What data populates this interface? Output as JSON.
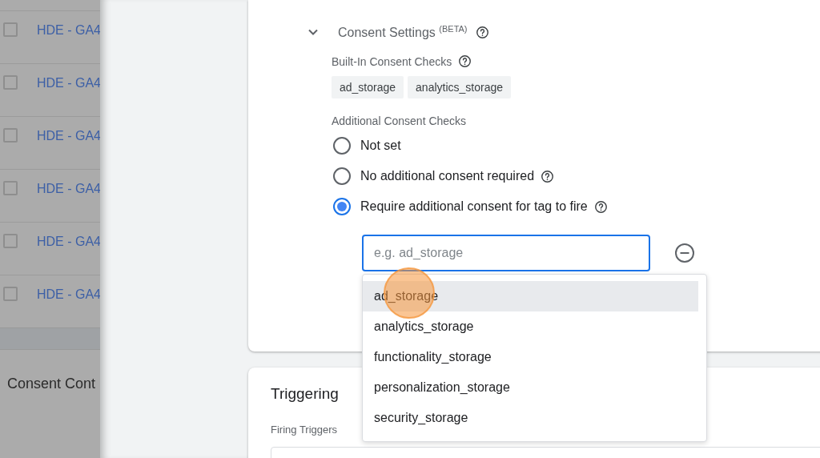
{
  "tag_list": {
    "rows": [
      {
        "checked": false,
        "name": "HDE - GA4"
      },
      {
        "checked": false,
        "name": "HDE - GA4"
      },
      {
        "checked": false,
        "name": "HDE - GA4"
      },
      {
        "checked": false,
        "name": "HDE - GA4"
      },
      {
        "checked": false,
        "name": "HDE - GA4"
      },
      {
        "checked": false,
        "name": "HDE - GA4"
      }
    ],
    "section_title": "Consent Cont"
  },
  "consent_settings": {
    "expanded": true,
    "title": "Consent Settings $^{(BETA)}$",
    "built_in_label": "Built-In Consent Checks",
    "built_in_chips": [
      "ad_storage",
      "analytics_storage"
    ],
    "additional_label": "Additional Consent Checks",
    "options": [
      {
        "label": "Not set",
        "help": false,
        "selected": false
      },
      {
        "label": "No additional consent required",
        "help": true,
        "selected": false
      },
      {
        "label": "Require additional consent for tag to fire",
        "help": true,
        "selected": true
      }
    ],
    "consent_field": {
      "placeholder": "e.g. ad_storage"
    },
    "suggestions": [
      {
        "label": "ad_storage",
        "highlighted": true
      },
      {
        "label": "analytics_storage",
        "highlighted": false
      },
      {
        "label": "functionality_storage",
        "highlighted": false
      },
      {
        "label": "personalization_storage",
        "highlighted": false
      },
      {
        "label": "security_storage",
        "highlighted": false
      }
    ]
  },
  "triggering": {
    "title": "Triggering",
    "firing_triggers_label": "Firing Triggers"
  }
}
